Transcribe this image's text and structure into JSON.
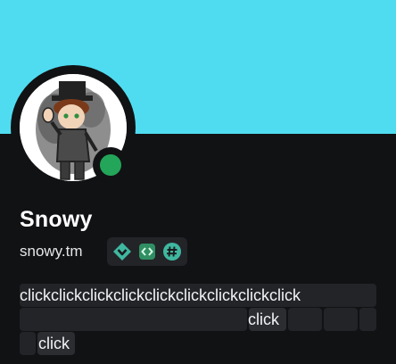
{
  "profile": {
    "display_name": "Snowy",
    "username": "snowy.tm",
    "status": "online",
    "status_color": "#23a55a",
    "banner_color": "#4fdcf0"
  },
  "badges": [
    {
      "name": "hypesquad-badge-icon",
      "color": "#3fb8a0"
    },
    {
      "name": "active-developer-badge-icon",
      "color": "#2f8f63"
    },
    {
      "name": "hashtag-badge-icon",
      "color": "#3fb8a0"
    }
  ],
  "bio": {
    "line1": "clickclickclickclickclickclickclickclickclick",
    "line2_click": "click",
    "line3_click": "click"
  }
}
